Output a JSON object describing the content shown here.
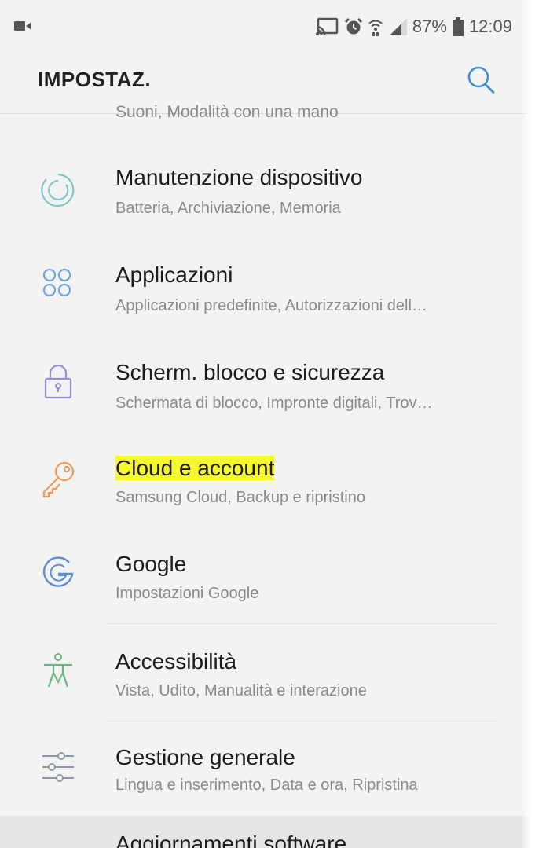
{
  "status_bar": {
    "battery_percent": "87%",
    "time": "12:09",
    "icons": [
      "video-icon",
      "cast-icon",
      "alarm-icon",
      "wifi-icon",
      "signal-icon",
      "battery-icon"
    ]
  },
  "header": {
    "title": "IMPOSTAZ.",
    "search_icon": "search-icon"
  },
  "list": {
    "partial_top_subtitle": "Suoni, Modalità con una mano",
    "items": [
      {
        "title": "Manutenzione dispositivo",
        "subtitle": "Batteria, Archiviazione, Memoria",
        "icon": "device-maintenance-icon",
        "icon_color": "#7fc6c9"
      },
      {
        "title": "Applicazioni",
        "subtitle": "Applicazioni predefinite, Autorizzazioni dell…",
        "icon": "apps-icon",
        "icon_color": "#6fa6df"
      },
      {
        "title": "Scherm. blocco e sicurezza",
        "subtitle": "Schermata di blocco, Impronte digitali, Trov…",
        "icon": "lock-icon",
        "icon_color": "#9a8fd6"
      },
      {
        "title": "Cloud e account",
        "subtitle": "Samsung Cloud, Backup e ripristino",
        "icon": "key-icon",
        "icon_color": "#ef9a5a",
        "highlighted": true
      },
      {
        "title": "Google",
        "subtitle": "Impostazioni Google",
        "icon": "google-icon",
        "icon_color": "#5b8ed8"
      },
      {
        "title": "Accessibilità",
        "subtitle": "Vista, Udito, Manualità e interazione",
        "icon": "accessibility-icon",
        "icon_color": "#67b97e"
      },
      {
        "title": "Gestione generale",
        "subtitle": "Lingua e inserimento, Data e ora, Ripristina",
        "icon": "sliders-icon",
        "icon_color": "#8f9aa6"
      }
    ],
    "partial_bottom_title": "Aggiornamenti software"
  },
  "colors": {
    "background": "#f3f3f3",
    "highlight": "#f6f631",
    "title_text": "#1c1c1c",
    "subtitle_text": "#8a8a8a"
  }
}
